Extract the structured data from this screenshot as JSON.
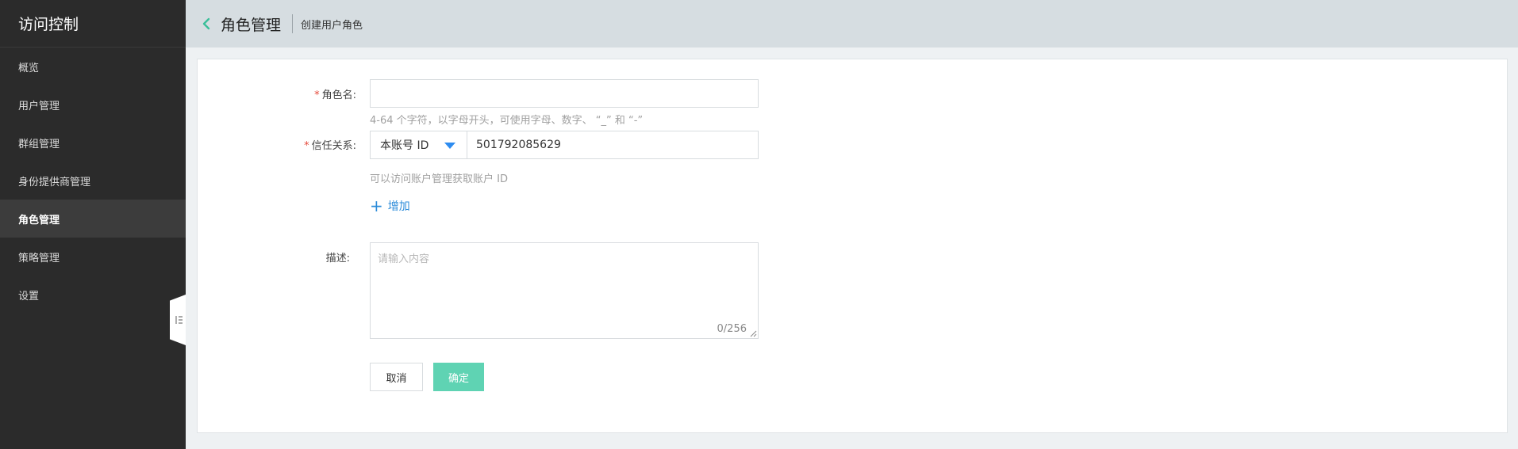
{
  "app": {
    "title": "访问控制"
  },
  "sidebar": {
    "items": [
      {
        "label": "概览",
        "active": false
      },
      {
        "label": "用户管理",
        "active": false
      },
      {
        "label": "群组管理",
        "active": false
      },
      {
        "label": "身份提供商管理",
        "active": false
      },
      {
        "label": "角色管理",
        "active": true
      },
      {
        "label": "策略管理",
        "active": false
      },
      {
        "label": "设置",
        "active": false
      }
    ],
    "collapse_icon": "collapse-sidebar-icon"
  },
  "header": {
    "back_icon": "chevron-left-icon",
    "title": "角色管理",
    "subtitle": "创建用户角色"
  },
  "form": {
    "role_name": {
      "required_mark": "*",
      "label": "角色名:",
      "value": "",
      "hint": "4-64 个字符，以字母开头，可使用字母、数字、 “_” 和 “-”"
    },
    "trust": {
      "required_mark": "*",
      "label": "信任关系:",
      "select_value": "本账号 ID",
      "account_id": "501792085629",
      "hint": "可以访问账户管理获取账户 ID"
    },
    "add": {
      "icon": "plus-icon",
      "plus_glyph": "+",
      "label": "增加"
    },
    "description": {
      "label": "描述:",
      "placeholder": "请输入内容",
      "counter": "0/256"
    },
    "buttons": {
      "cancel": "取消",
      "confirm": "确定"
    }
  },
  "colors": {
    "sidebar_bg": "#2b2b2b",
    "header_bg": "#d6dde1",
    "accent_green": "#5fd3b3",
    "link_blue": "#2b8bd9",
    "required_red": "#e64a3b"
  }
}
